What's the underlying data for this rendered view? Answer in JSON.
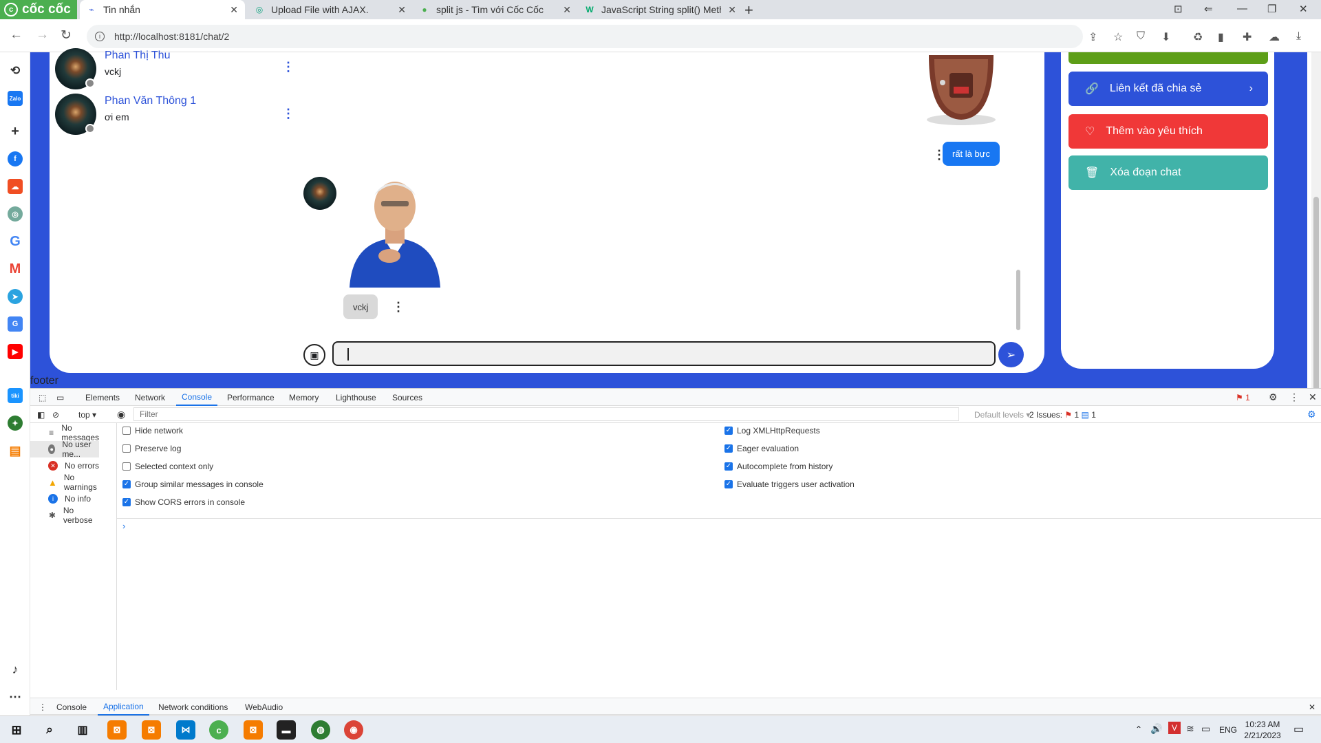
{
  "browser": {
    "brand": "cốc cốc",
    "tabs": [
      {
        "title": "Tin nhắn",
        "active": true
      },
      {
        "title": "Upload File with AJAX.",
        "active": false
      },
      {
        "title": "split js - Tìm với Cốc Cốc",
        "active": false
      },
      {
        "title": "JavaScript String split() Meth",
        "active": false
      }
    ],
    "url": "http://localhost:8181/chat/2"
  },
  "chat": {
    "contacts": [
      {
        "name": "Phan Thị Thu",
        "last_message": "vckj"
      },
      {
        "name": "Phan Văn Thông 1",
        "last_message": "ơi em"
      }
    ],
    "messages": {
      "outgoing_text": "rất là bực",
      "incoming_text": "vckj"
    },
    "input_value": ""
  },
  "right_panel": {
    "shared_links_label": "Liên kết đã chia sẻ",
    "favorite_label": "Thêm vào yêu thích",
    "delete_label": "Xóa đoạn chat",
    "colors": {
      "shared": "#2d52d9",
      "favorite": "#f03838",
      "delete": "#41b3a9",
      "top": "#5d9e18"
    }
  },
  "footer_text": "footer",
  "devtools": {
    "tabs": [
      "Elements",
      "Network",
      "Console",
      "Performance",
      "Memory",
      "Lighthouse",
      "Sources"
    ],
    "active_tab": "Console",
    "error_badge": "1",
    "context": "top",
    "filter_placeholder": "Filter",
    "levels": "Default levels",
    "issues_label": "2 Issues:",
    "issues_errors": "1",
    "issues_info": "1",
    "sidebar_filters": [
      "No messages",
      "No user me...",
      "No errors",
      "No warnings",
      "No info",
      "No verbose"
    ],
    "options_left": [
      {
        "label": "Hide network",
        "checked": false
      },
      {
        "label": "Preserve log",
        "checked": false
      },
      {
        "label": "Selected context only",
        "checked": false
      },
      {
        "label": "Group similar messages in console",
        "checked": true
      },
      {
        "label": "Show CORS errors in console",
        "checked": true
      }
    ],
    "options_right": [
      {
        "label": "Log XMLHttpRequests",
        "checked": true
      },
      {
        "label": "Eager evaluation",
        "checked": true
      },
      {
        "label": "Autocomplete from history",
        "checked": true
      },
      {
        "label": "Evaluate triggers user activation",
        "checked": true
      }
    ],
    "drawer_tabs": [
      "Console",
      "Application",
      "Network conditions",
      "WebAudio"
    ],
    "drawer_active": "Application"
  },
  "taskbar": {
    "language": "ENG",
    "time": "10:23 AM",
    "date": "2/21/2023"
  }
}
